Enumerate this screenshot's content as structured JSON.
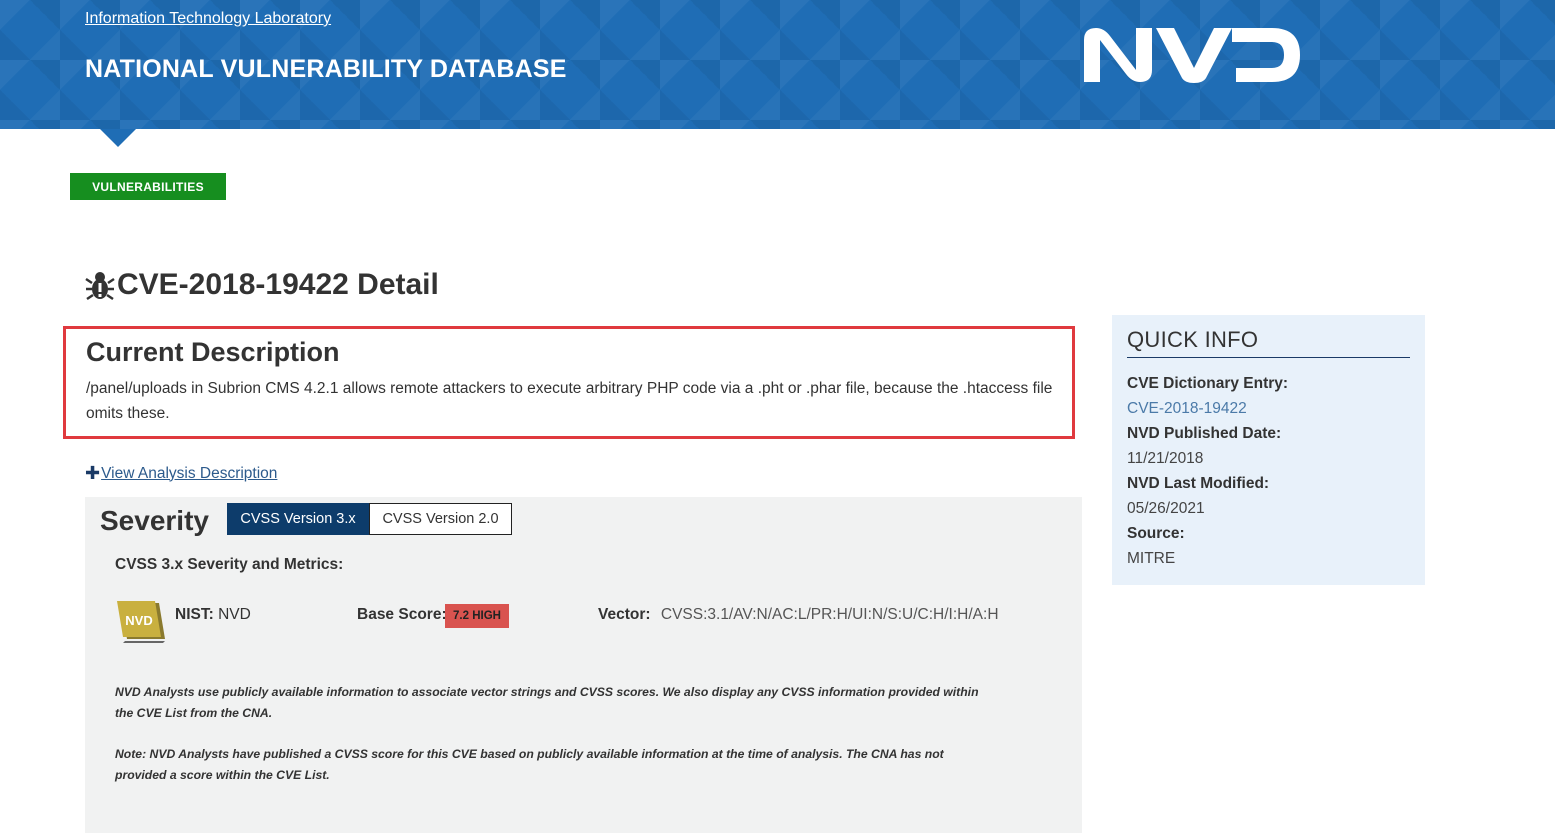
{
  "header": {
    "org_link": "Information Technology Laboratory",
    "title": "NATIONAL VULNERABILITY DATABASE",
    "logo_text": "NVD",
    "colors": {
      "banner": "#1f6db5"
    }
  },
  "nav": {
    "tag_label": "VULNERABILITIES",
    "tag_color": "#168e1f"
  },
  "page": {
    "title": "CVE-2018-19422 Detail",
    "title_icon": "bug-icon"
  },
  "description": {
    "heading": "Current Description",
    "text": "/panel/uploads in Subrion CMS 4.2.1 allows remote attackers to execute arbitrary PHP code via a .pht or .phar file, because the .htaccess file omits these.",
    "highlight_color": "#e0393e"
  },
  "view_analysis": {
    "label": "View Analysis Description"
  },
  "severity": {
    "heading": "Severity",
    "tabs": [
      {
        "label": "CVSS Version 3.x",
        "active": true
      },
      {
        "label": "CVSS Version 2.0",
        "active": false
      }
    ],
    "metrics_heading": "CVSS 3.x Severity and Metrics:",
    "badge_text": "NVD",
    "nist_label": "NIST:",
    "nist_value": "NVD",
    "base_score_label": "Base Score:",
    "base_score_value": "7.2 HIGH",
    "vector_label": "Vector:",
    "vector_value": "CVSS:3.1/AV:N/AC:L/PR:H/UI:N/S:U/C:H/I:H/A:H",
    "note_1": "NVD Analysts use publicly available information to associate vector strings and CVSS scores. We also display any CVSS information provided within the CVE List from the CNA.",
    "note_2": "Note: NVD Analysts have published a CVSS score for this CVE based on publicly available information at the time of analysis. The CNA has not provided a score within the CVE List."
  },
  "quick_info": {
    "heading": "QUICK INFO",
    "dictionary_label": "CVE Dictionary Entry:",
    "dictionary_value": "CVE-2018-19422",
    "published_label": "NVD Published Date:",
    "published_value": "11/21/2018",
    "modified_label": "NVD Last Modified:",
    "modified_value": "05/26/2021",
    "source_label": "Source:",
    "source_value": "MITRE"
  }
}
